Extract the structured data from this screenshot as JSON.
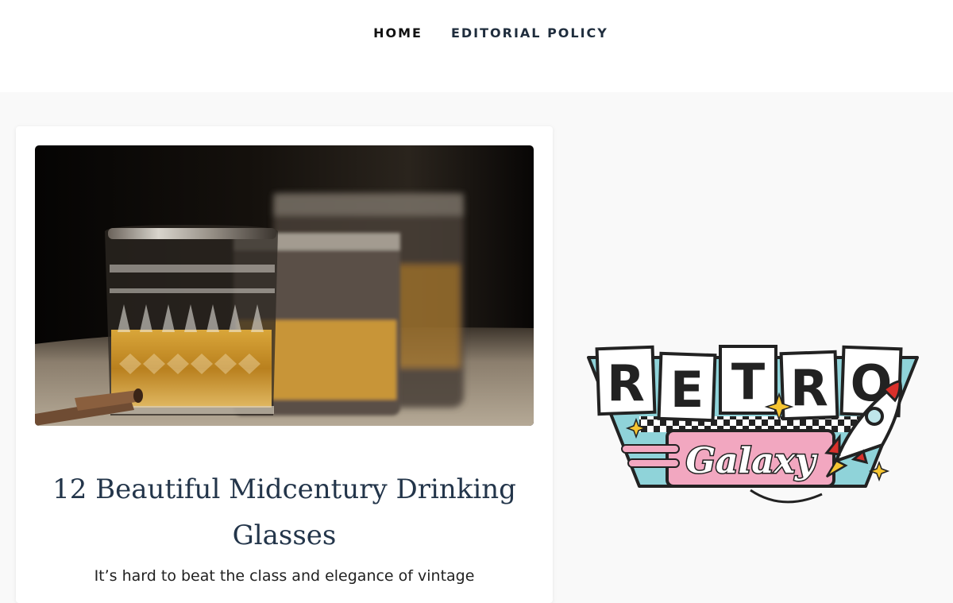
{
  "nav": {
    "items": [
      {
        "label": "HOME"
      },
      {
        "label": "EDITORIAL POLICY"
      }
    ]
  },
  "post": {
    "title": "12 Beautiful Midcentury Drinking Glasses",
    "excerpt": "It’s hard to beat the class and elegance of vintage",
    "image_subject": "whiskey glasses with cigar"
  },
  "logo": {
    "letters": [
      "R",
      "E",
      "T",
      "R",
      "O"
    ],
    "script_text": "Galaxy"
  },
  "colors": {
    "nav_text": "#1f2d3d",
    "title_text": "#23354a",
    "logo_teal": "#8fd3d9",
    "logo_pink": "#f2a7c0",
    "logo_red": "#d9302b"
  }
}
